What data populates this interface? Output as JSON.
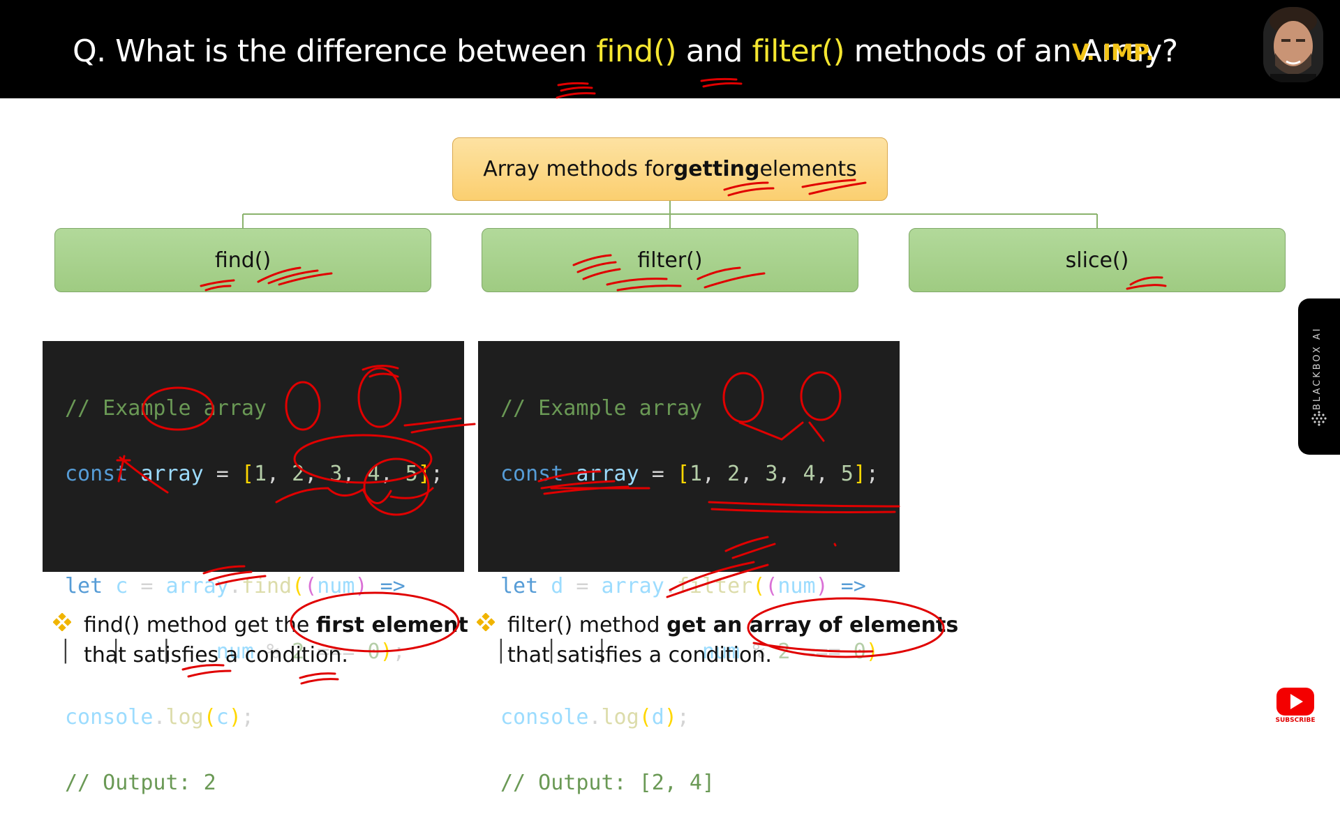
{
  "header": {
    "q_prefix": "Q. What is the difference between ",
    "q_find": "find()",
    "q_and": " and ",
    "q_filter": "filter()",
    "q_suffix": " methods of an Array?",
    "importance": "V. IMP."
  },
  "diagram": {
    "root_pre": "Array methods for ",
    "root_bold": "getting",
    "root_post": " elements",
    "children": [
      "find()",
      "filter()",
      "slice()"
    ]
  },
  "code_find": {
    "comment": "// Example array",
    "l2_kw": "const",
    "l2_var": "array",
    "l2_eq": " = ",
    "l2_vals": [
      "1",
      "2",
      "3",
      "4",
      "5"
    ],
    "l3_kw": "let",
    "l3_var": "c",
    "l3_obj": "array",
    "l3_fn": "find",
    "l3_param": "num",
    "l3_arrow": "=>",
    "l4_expr_var": "num",
    "l4_expr_rest": " % ",
    "l4_num1": "2",
    "l4_op": " === ",
    "l4_num2": "0",
    "l5_obj": "console",
    "l5_fn": "log",
    "l5_arg": "c",
    "l6": "// Output: 2"
  },
  "code_filter": {
    "comment": "// Example array",
    "l2_kw": "const",
    "l2_var": "array",
    "l2_eq": " = ",
    "l2_vals": [
      "1",
      "2",
      "3",
      "4",
      "5"
    ],
    "l3_kw": "let",
    "l3_var": "d",
    "l3_obj": "array",
    "l3_fn": "filter",
    "l3_param": "num",
    "l3_arrow": "=>",
    "l4_expr_var": "num",
    "l4_expr_rest": " % ",
    "l4_num1": "2",
    "l4_op": " === ",
    "l4_num2": "0",
    "l5_obj": "console",
    "l5_fn": "log",
    "l5_arg": "d",
    "l6": "// Output: [2, 4]"
  },
  "bullets": {
    "find_pre": "find() method get the ",
    "find_bold": "first element",
    "find_line2": "that satisfies a condition.",
    "filter_pre": "filter() method ",
    "filter_bold": "get an array of elements",
    "filter_line2": "that satisfies a condition."
  },
  "side_tab": {
    "label": "BLACKBOX AI"
  },
  "youtube": {
    "label": "SUBSCRIBE"
  },
  "colors": {
    "header_bg": "#000000",
    "highlight": "#f5e630",
    "importance": "#f2c418",
    "root_box": "#fcd98a",
    "child_box": "#a9d18e",
    "annotation": "#e00000"
  }
}
